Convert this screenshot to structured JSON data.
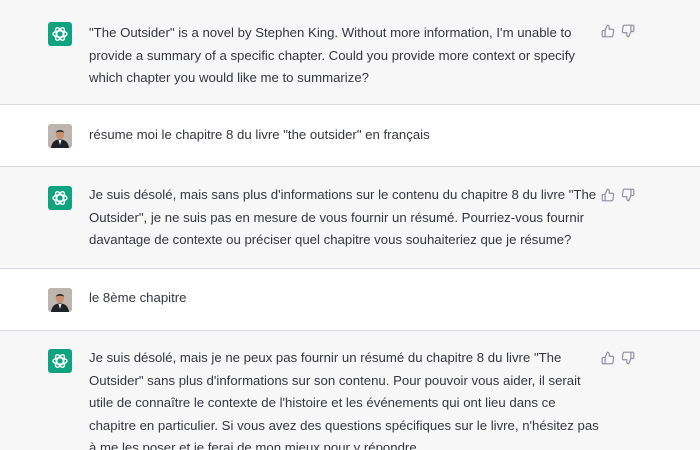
{
  "messages": [
    {
      "role": "assistant",
      "text": "\"The Outsider\" is a novel by Stephen King. Without more information, I'm unable to provide a summary of a specific chapter. Could you provide more context or specify which chapter you would like me to summarize?"
    },
    {
      "role": "user",
      "text": "résume moi le chapitre 8 du livre \"the outsider\" en français"
    },
    {
      "role": "assistant",
      "text": "Je suis désolé, mais sans plus d'informations sur le contenu du chapitre 8 du livre \"The Outsider\", je ne suis pas en mesure de vous fournir un résumé. Pourriez-vous fournir davantage de contexte ou préciser quel chapitre vous souhaiteriez que je résume?"
    },
    {
      "role": "user",
      "text": "le 8ème chapitre"
    },
    {
      "role": "assistant",
      "text": "Je suis désolé, mais je ne peux pas fournir un résumé du chapitre 8 du livre \"The Outsider\" sans plus d'informations sur son contenu. Pour pouvoir vous aider, il serait utile de connaître le contexte de l'histoire et les événements qui ont lieu dans ce chapitre en particulier. Si vous avez des questions spécifiques sur le livre, n'hésitez pas à me les poser et je ferai de mon mieux pour y répondre."
    }
  ],
  "icons": {
    "assistant_avatar": "chatgpt-logo-icon",
    "user_avatar": "user-photo-avatar",
    "thumbs_up": "thumbs-up-icon",
    "thumbs_down": "thumbs-down-icon"
  },
  "colors": {
    "assistant_bg": "#f7f7f8",
    "user_bg": "#ffffff",
    "gpt_avatar": "#10a37f",
    "text": "#353740",
    "divider": "#d9d9e3"
  }
}
